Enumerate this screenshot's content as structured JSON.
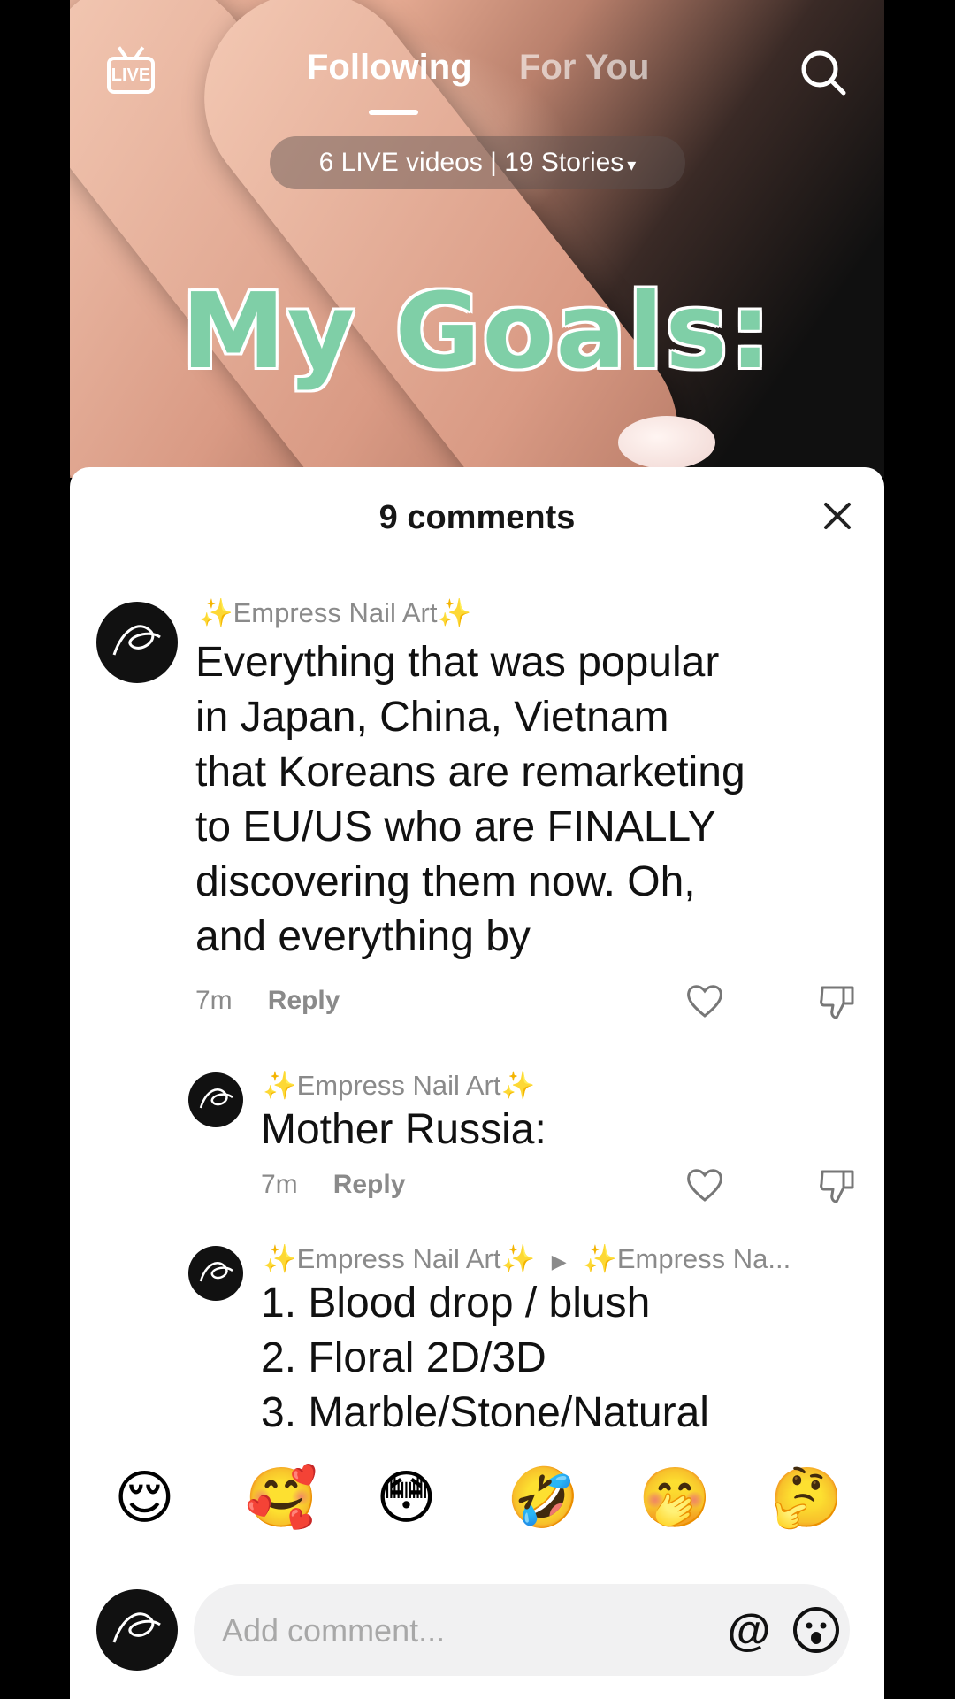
{
  "header": {
    "live_label": "LIVE",
    "tabs": [
      "Following",
      "For You"
    ],
    "stories_text": "6 LIVE videos | 19 Stories",
    "stories_caret": "▾"
  },
  "video": {
    "overlay_text": "My Goals:"
  },
  "comments": {
    "title": "9 comments",
    "items": [
      {
        "username": "Empress Nail Art",
        "text_lines": [
          "Everything that was popular",
          "in Japan, China, Vietnam",
          "that Koreans are remarketing",
          "to EU/US who are FINALLY",
          "discovering them now. Oh,",
          "and everything by"
        ],
        "time": "7m",
        "reply": "Reply"
      },
      {
        "username": "Empress Nail Art",
        "text_lines": [
          "Mother Russia:"
        ],
        "time": "7m",
        "reply": "Reply"
      },
      {
        "username": "Empress Nail Art",
        "reply_to": "Empress Na...",
        "text_lines": [
          "1. Blood drop / blush",
          "2. Floral 2D/3D",
          "3. Marble/Stone/Natural"
        ]
      }
    ]
  },
  "emoji_row": [
    "😌",
    "🥰",
    "😳",
    "🤣",
    "🤭",
    "🤔"
  ],
  "input": {
    "placeholder": "Add comment...",
    "at_label": "@"
  },
  "colors": {
    "overlay_text": "#7fcfa7",
    "sheet_bg": "#ffffff",
    "muted": "#8a8a8a"
  }
}
